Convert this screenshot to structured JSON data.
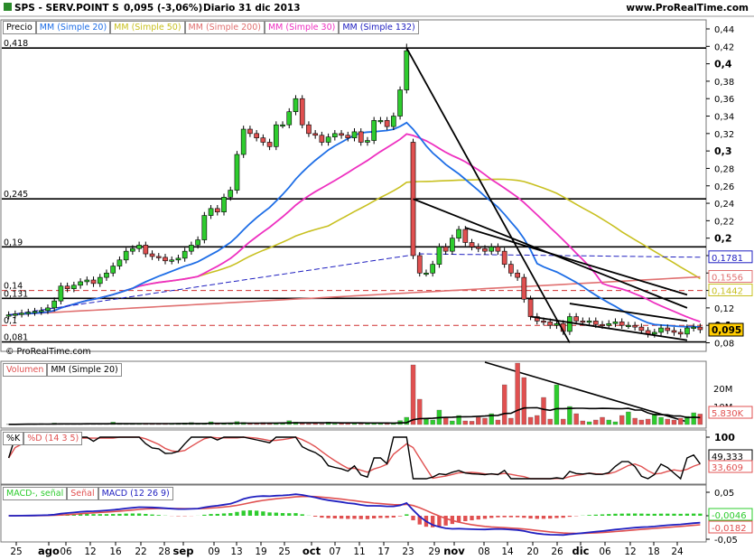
{
  "header": {
    "symbol_line": "SPS - SERV.POINT S",
    "price_change": "0,095 (-3,06%)",
    "period_date": "Diario  31 dic 2013",
    "site": "www.ProRealTime.com"
  },
  "watermark": "© ProRealTime.com",
  "price_legend": [
    "Precio",
    "MM (Simple 20)",
    "MM (Simple 50)",
    "MM (Simple 200)",
    "MM (Simple 30)",
    "MM (Simple 132)"
  ],
  "volume_legend": [
    "Volumen",
    "MM (Simple 20)"
  ],
  "stoch_legend": [
    "%K",
    "%D (14 3 5)"
  ],
  "macd_legend": [
    "MACD-, señal",
    "Señal",
    "MACD (12 26 9)"
  ],
  "colors": {
    "up": "#2ecc2e",
    "down": "#e05050",
    "ma20": "#1e6ee6",
    "ma50": "#c8c020",
    "ma200": "#e07070",
    "ma30": "#ee30c0",
    "ma132": "#2020c0",
    "trend": "#000000"
  },
  "chart_data": [
    {
      "type": "candlestick",
      "panel": "price",
      "ylim": [
        0.08,
        0.44
      ],
      "y_ticks": [
        "0,44",
        "0,42",
        "0,4",
        "0,38",
        "0,36",
        "0,34",
        "0,32",
        "0,3",
        "0,28",
        "0,26",
        "0,24",
        "0,22",
        "0,2",
        "0,18",
        "0,16",
        "0,14",
        "0,12",
        "0,1",
        "0,08"
      ],
      "x_tick_labels": [
        "25",
        "ago",
        "06",
        "12",
        "16",
        "22",
        "28",
        "sep",
        "09",
        "13",
        "19",
        "25",
        "oct",
        "07",
        "11",
        "17",
        "23",
        "29",
        "nov",
        "08",
        "14",
        "20",
        "26",
        "dic",
        "06",
        "12",
        "18",
        "24"
      ],
      "horizontal_levels": [
        {
          "label": "0,418",
          "value": 0.418
        },
        {
          "label": "0,245",
          "value": 0.245
        },
        {
          "label": "0,19",
          "value": 0.19
        },
        {
          "label": "0,14",
          "value": 0.14
        },
        {
          "label": "0,131",
          "value": 0.131
        },
        {
          "label": "0,1",
          "value": 0.1
        },
        {
          "label": "0,081",
          "value": 0.081
        }
      ],
      "value_tags": [
        {
          "label": "0,1781",
          "value": 0.1781,
          "series": "MM (Simple 132)"
        },
        {
          "label": "0,1556",
          "value": 0.1556,
          "series": "MM (Simple 200)"
        },
        {
          "label": "0,1442",
          "value": 0.1442,
          "series": "MM (Simple 50)"
        },
        {
          "label": "0,095",
          "value": 0.095,
          "series": "Precio"
        }
      ],
      "close": [
        0.112,
        0.113,
        0.114,
        0.115,
        0.116,
        0.117,
        0.12,
        0.128,
        0.145,
        0.142,
        0.146,
        0.15,
        0.152,
        0.148,
        0.155,
        0.16,
        0.168,
        0.175,
        0.185,
        0.188,
        0.192,
        0.182,
        0.179,
        0.178,
        0.174,
        0.175,
        0.177,
        0.185,
        0.192,
        0.198,
        0.226,
        0.234,
        0.23,
        0.247,
        0.255,
        0.296,
        0.325,
        0.32,
        0.315,
        0.31,
        0.305,
        0.33,
        0.33,
        0.345,
        0.36,
        0.33,
        0.32,
        0.318,
        0.31,
        0.316,
        0.32,
        0.318,
        0.315,
        0.322,
        0.31,
        0.312,
        0.335,
        0.335,
        0.328,
        0.34,
        0.37,
        0.415,
        0.18,
        0.16,
        0.16,
        0.17,
        0.19,
        0.185,
        0.2,
        0.21,
        0.195,
        0.19,
        0.188,
        0.185,
        0.19,
        0.185,
        0.17,
        0.16,
        0.155,
        0.13,
        0.11,
        0.105,
        0.104,
        0.1,
        0.102,
        0.093,
        0.11,
        0.105,
        0.104,
        0.105,
        0.101,
        0.1,
        0.102,
        0.104,
        0.1,
        0.1,
        0.098,
        0.094,
        0.09,
        0.092,
        0.097,
        0.094,
        0.092,
        0.09,
        0.097,
        0.098,
        0.095
      ],
      "series": [
        {
          "name": "MM (Simple 20)"
        },
        {
          "name": "MM (Simple 50)"
        },
        {
          "name": "MM (Simple 200)"
        },
        {
          "name": "MM (Simple 30)"
        },
        {
          "name": "MM (Simple 132)"
        }
      ]
    },
    {
      "type": "bar",
      "panel": "volume",
      "y_ticks": [
        "20M",
        "10M"
      ],
      "value_tags": [
        {
          "label": "5.830K",
          "value": 5830000
        }
      ],
      "values_m": [
        0.1,
        0.1,
        0.2,
        0.3,
        0.2,
        0.5,
        0.3,
        0.8,
        0.6,
        0.4,
        0.5,
        0.3,
        0.6,
        0.5,
        0.4,
        0.4,
        1.3,
        0.7,
        0.5,
        0.6,
        0.4,
        0.5,
        0.4,
        0.3,
        0.4,
        0.5,
        0.4,
        0.9,
        1.1,
        0.6,
        0.7,
        1.5,
        0.9,
        0.6,
        0.8,
        1.6,
        1.2,
        0.8,
        0.7,
        1.1,
        0.6,
        0.9,
        1.0,
        2.1,
        1.3,
        0.6,
        0.5,
        0.7,
        0.4,
        1.4,
        0.5,
        0.6,
        0.8,
        0.5,
        0.4,
        1.0,
        0.8,
        0.9,
        0.5,
        0.9,
        2.2,
        4.0,
        33.0,
        14.0,
        3.0,
        2.5,
        8.0,
        4.0,
        2.0,
        5.0,
        2.0,
        1.8,
        4.0,
        3.5,
        6.0,
        2.5,
        22.0,
        3.5,
        34.0,
        26.0,
        4.0,
        5.0,
        15.0,
        3.0,
        22.0,
        3.0,
        10.0,
        6.0,
        2.0,
        1.5,
        2.5,
        4.0,
        2.5,
        1.5,
        5.0,
        7.0,
        3.5,
        2.5,
        3.0,
        6.0,
        4.0,
        3.0,
        2.5,
        3.5,
        4.5,
        6.5,
        5.8
      ]
    },
    {
      "type": "line",
      "panel": "stochastic",
      "y_ticks": [
        "100"
      ],
      "value_tags": [
        {
          "label": "49,333",
          "value": 49.333
        },
        {
          "label": "33,609",
          "value": 33.609
        }
      ],
      "series": [
        {
          "name": "%K"
        },
        {
          "name": "%D (14 3 5)"
        }
      ]
    },
    {
      "type": "line",
      "panel": "macd",
      "y_ticks": [
        "0,05",
        "0",
        "-0,05"
      ],
      "value_tags": [
        {
          "label": "-0,0046",
          "value": -0.0046
        },
        {
          "label": "-0,0182",
          "value": -0.0182
        }
      ],
      "series": [
        {
          "name": "MACD-, señal"
        },
        {
          "name": "Señal"
        },
        {
          "name": "MACD (12 26 9)"
        }
      ]
    }
  ]
}
